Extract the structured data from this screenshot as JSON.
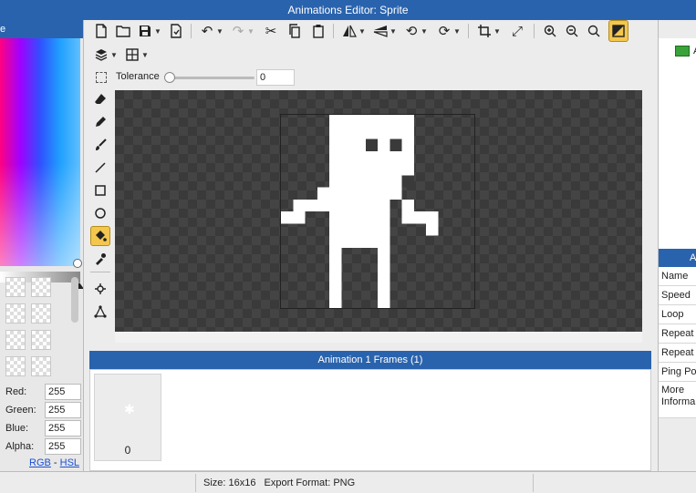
{
  "window": {
    "title": "Animations Editor: Sprite"
  },
  "left_panel": {
    "header": "e",
    "color": {
      "red": "255",
      "green": "255",
      "blue": "255",
      "alpha": "255"
    },
    "labels": {
      "red": "Red:",
      "green": "Green:",
      "blue": "Blue:",
      "alpha": "Alpha:"
    },
    "mode_rgb": "RGB",
    "mode_sep": " - ",
    "mode_hsl": "HSL"
  },
  "toolbar": {
    "icons": [
      "new-file-icon",
      "open-folder-icon",
      "save-icon",
      "export-icon",
      "undo-icon",
      "redo-icon",
      "cut-icon",
      "copy-icon",
      "paste-icon",
      "flip-horizontal-icon",
      "flip-vertical-icon",
      "rotate-left-icon",
      "rotate-right-icon",
      "crop-icon",
      "resize-icon",
      "zoom-in-icon",
      "zoom-out-icon",
      "zoom-fit-icon",
      "toggle-bg-icon",
      "layers-icon",
      "grid-icon"
    ]
  },
  "tolerance": {
    "label": "Tolerance",
    "value": "0"
  },
  "tools": [
    "eraser-icon",
    "pencil-icon",
    "brush-icon",
    "line-icon",
    "rectangle-icon",
    "ellipse-icon",
    "fill-bucket-icon",
    "eyedropper-icon",
    "pivot-icon",
    "skeleton-icon"
  ],
  "canvas": {
    "sprite_color": "#ffffff",
    "background": "#3a3a3a"
  },
  "frames": {
    "header": "Animation 1 Frames (1)",
    "items": [
      {
        "index": "0"
      }
    ]
  },
  "right_panel": {
    "anim_label": "A",
    "props_header": "A",
    "properties": [
      "Name",
      "Speed",
      "Loop",
      "Repeat",
      "Repeat",
      "Ping Po",
      "More Informa"
    ]
  },
  "status": {
    "size": "Size: 16x16",
    "format": "Export Format: PNG"
  }
}
